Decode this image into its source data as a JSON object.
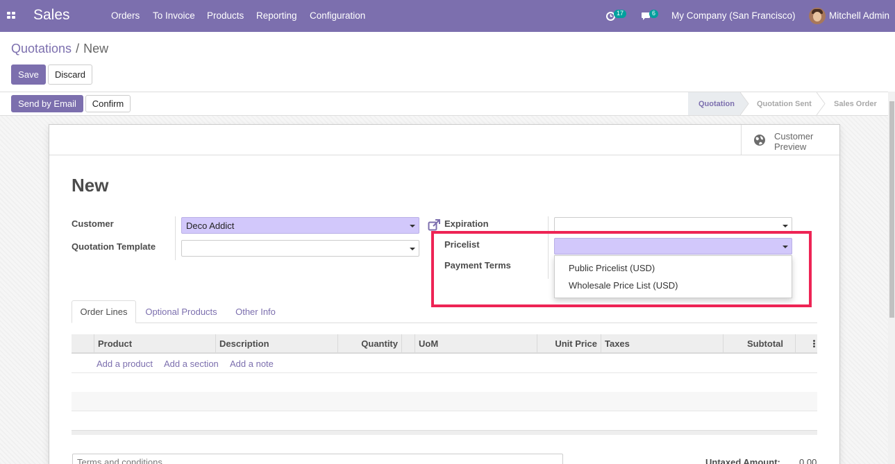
{
  "navbar": {
    "app_name": "Sales",
    "menu": [
      "Orders",
      "To Invoice",
      "Products",
      "Reporting",
      "Configuration"
    ],
    "activity_count": "17",
    "message_count": "6",
    "company": "My Company (San Francisco)",
    "user": "Mitchell Admin",
    "icons": [
      "apps-icon",
      "clock-icon",
      "chat-icon",
      "avatar"
    ]
  },
  "breadcrumb": {
    "parent": "Quotations",
    "separator": "/",
    "current": "New"
  },
  "control_panel": {
    "save_label": "Save",
    "discard_label": "Discard"
  },
  "header": {
    "send_email_label": "Send by Email",
    "confirm_label": "Confirm",
    "statuses": [
      "Quotation",
      "Quotation Sent",
      "Sales Order"
    ],
    "active_status": "Quotation"
  },
  "sheet": {
    "customer_preview": [
      "Customer",
      "Preview"
    ],
    "title": "New",
    "fields": {
      "customer_label": "Customer",
      "customer_value": "Deco Addict",
      "quotation_template_label": "Quotation Template",
      "quotation_template_value": "",
      "expiration_label": "Expiration",
      "expiration_value": "",
      "pricelist_label": "Pricelist",
      "pricelist_value": "",
      "payment_terms_label": "Payment Terms"
    },
    "pricelist_options": [
      "Public Pricelist (USD)",
      "Wholesale Price List (USD)"
    ],
    "tabs": [
      "Order Lines",
      "Optional Products",
      "Other Info"
    ],
    "active_tab": "Order Lines",
    "table": {
      "columns": [
        "Product",
        "Description",
        "Quantity",
        "UoM",
        "Unit Price",
        "Taxes",
        "Subtotal"
      ],
      "actions": [
        "Add a product",
        "Add a section",
        "Add a note"
      ]
    },
    "terms_placeholder": "Terms and conditions...",
    "untaxed_amount_label": "Untaxed Amount:",
    "untaxed_amount_value": "0.00"
  },
  "colors": {
    "brand": "#7c6fae",
    "highlight": "#ee2455",
    "required_field": "#d2c8fb",
    "badge": "#00a09d"
  }
}
